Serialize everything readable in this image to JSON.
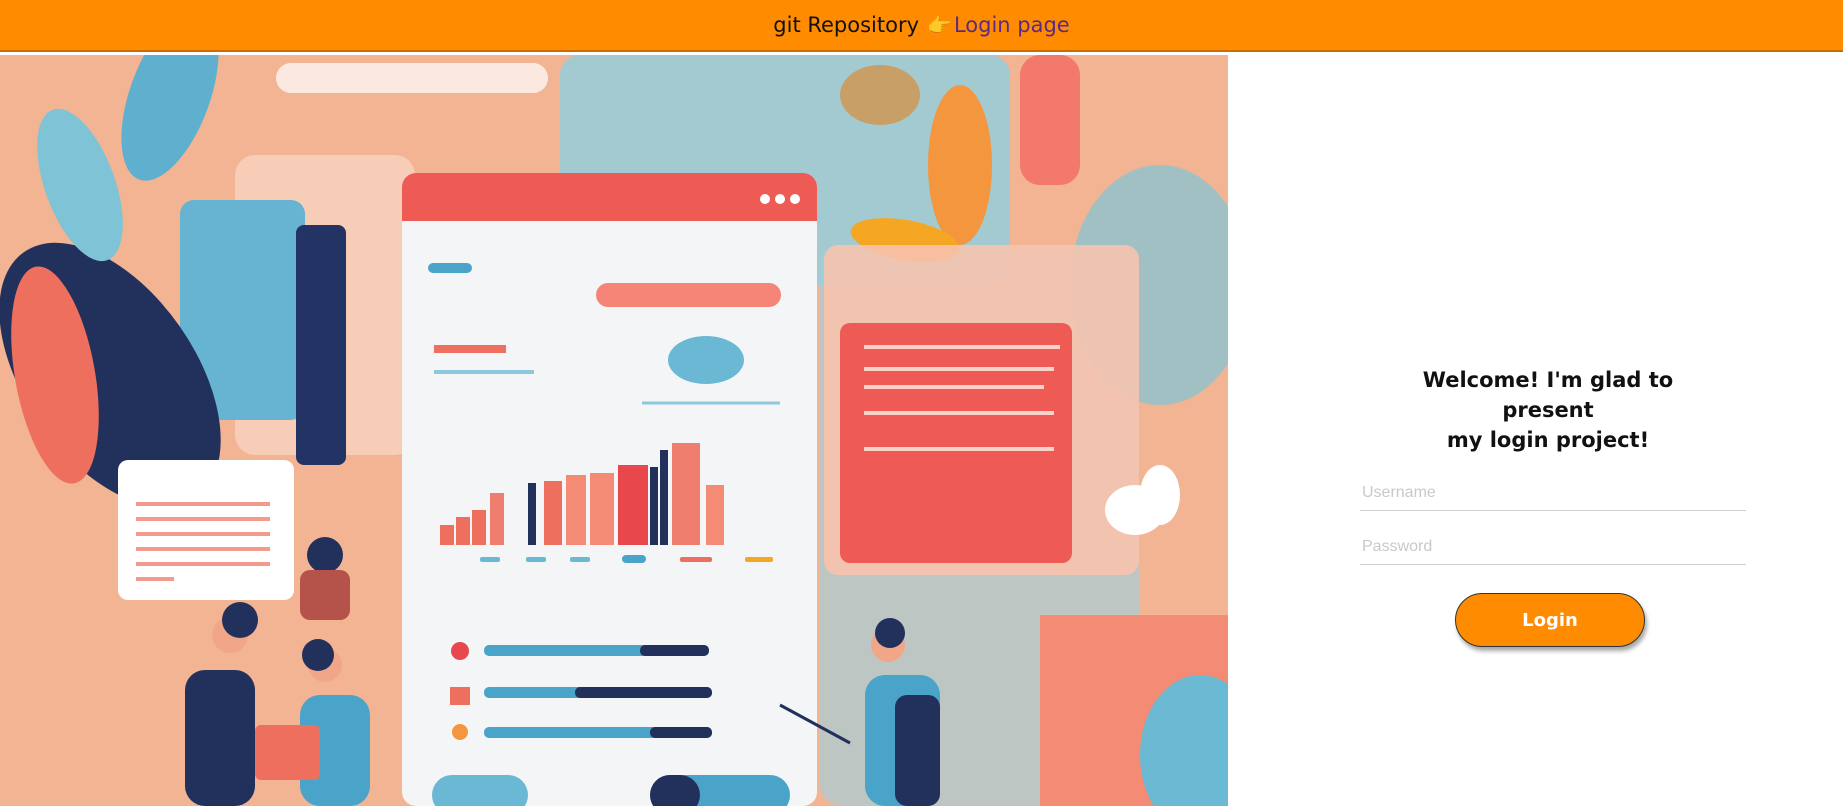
{
  "header": {
    "brand": "git Repository",
    "pointer_icon": "👉",
    "link_label": "Login page"
  },
  "login": {
    "welcome_line1": "Welcome! I'm glad to present",
    "welcome_line2": "my login project!",
    "username_placeholder": "Username",
    "password_placeholder": "Password",
    "button_label": "Login"
  },
  "colors": {
    "accent": "#ff8c00",
    "link": "#5b2a86"
  }
}
